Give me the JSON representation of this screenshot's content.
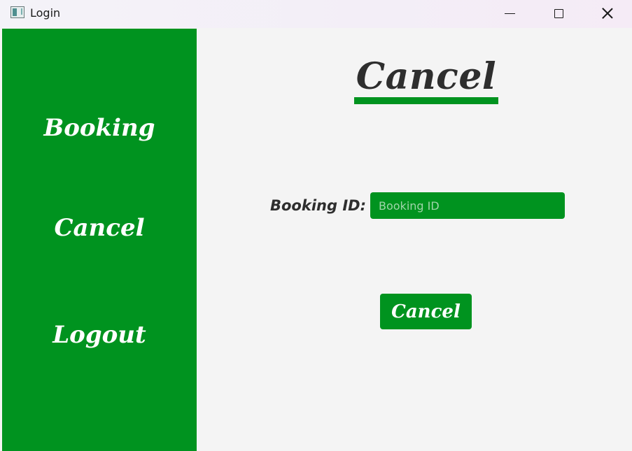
{
  "window": {
    "title": "Login"
  },
  "sidebar": {
    "items": [
      {
        "label": "Booking"
      },
      {
        "label": "Cancel"
      },
      {
        "label": "Logout"
      }
    ]
  },
  "main": {
    "title": "Cancel",
    "booking_id_label": "Booking ID:",
    "booking_id_value": "",
    "booking_id_placeholder": "Booking ID",
    "submit_label": "Cancel"
  },
  "colors": {
    "accent": "#00931f",
    "text_dark": "#2e2e2e",
    "background": "#f4f4f4"
  },
  "icons": {
    "app": "app-window-icon",
    "minimize": "minimize-icon",
    "maximize": "maximize-icon",
    "close": "close-icon"
  }
}
